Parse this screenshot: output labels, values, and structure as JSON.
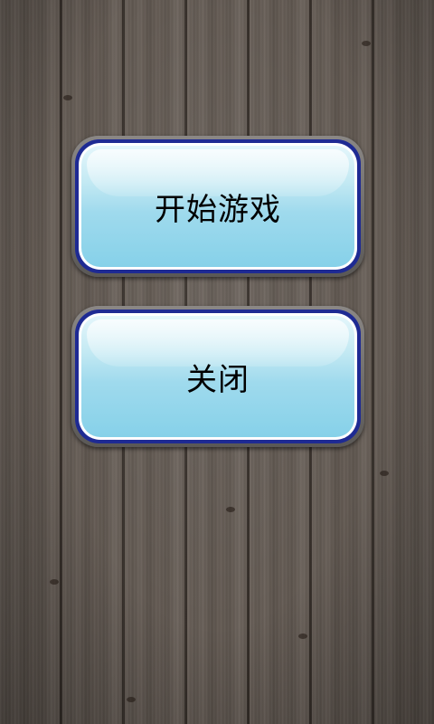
{
  "menu": {
    "start_label": "开始游戏",
    "close_label": "关闭"
  },
  "colors": {
    "button_border": "#1e2a93",
    "button_face_top": "#e4f6fb",
    "button_face_bottom": "#86d1e9",
    "label_text": "#000000"
  },
  "background": "wood-planks"
}
